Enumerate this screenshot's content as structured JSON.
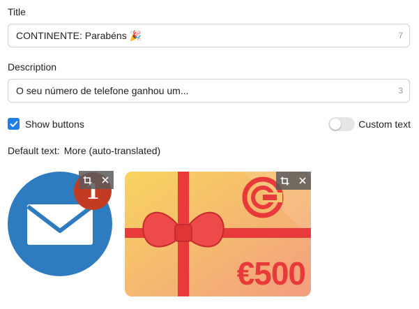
{
  "title_field": {
    "label": "Title",
    "value": "CONTINENTE: Parabéns 🎉",
    "count": "7"
  },
  "description_field": {
    "label": "Description",
    "value": "O seu número de telefone ganhou um...",
    "count": "3"
  },
  "show_buttons": {
    "label": "Show buttons",
    "checked": true
  },
  "custom_text": {
    "label": "Custom text",
    "enabled": false
  },
  "default_text": {
    "prefix": "Default text:",
    "value": "More (auto-translated)"
  },
  "images": [
    {
      "name": "mail-icon-image",
      "badge": "1",
      "colors": {
        "circle": "#2f7bbf",
        "envelope": "#ffffff",
        "badge": "#c23b22"
      }
    },
    {
      "name": "gift-card-image",
      "amount": "€500",
      "colors": {
        "card_start": "#f7cf63",
        "card_end": "#f4a07d",
        "ribbon": "#e83a3a"
      }
    }
  ],
  "colors": {
    "accent": "#1f7ee8",
    "border": "#cfcfcf",
    "counter": "#9a9a9a"
  }
}
